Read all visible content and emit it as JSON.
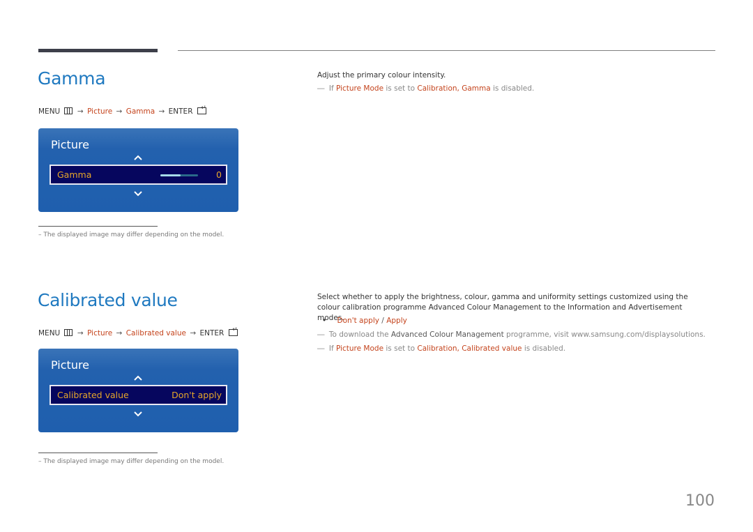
{
  "page_number": "100",
  "gamma": {
    "title": "Gamma",
    "menu_path": {
      "menu": "MENU",
      "arrow": "→",
      "items": [
        "Picture",
        "Gamma"
      ],
      "enter": "ENTER"
    },
    "osd": {
      "title": "Picture",
      "row_label": "Gamma",
      "row_value": "0",
      "slider_fraction": 0.53
    },
    "footnote": "–  The displayed image may differ depending on the model.",
    "description": "Adjust the primary colour intensity.",
    "note": {
      "dash": "―",
      "prefix": "If",
      "picture_mode": "Picture Mode",
      "mid": "is set to",
      "calibration": "Calibration,",
      "item": "Gamma",
      "suffix": "is disabled."
    }
  },
  "calibrated": {
    "title": "Calibrated value",
    "menu_path": {
      "menu": "MENU",
      "arrow": "→",
      "items": [
        "Picture",
        "Calibrated value"
      ],
      "enter": "ENTER"
    },
    "osd": {
      "title": "Picture",
      "row_label": "Calibrated value",
      "row_value": "Don't apply"
    },
    "footnote": "–  The displayed image may differ depending on the model.",
    "description_1": "Select whether to apply the brightness, colour, gamma and uniformity settings customized using the colour calibration programme",
    "description_bold": "Advanced Colour Management",
    "description_2": "to the Information and Advertisement modes.",
    "options": {
      "bullet": "•",
      "option_1": "Don't apply",
      "separator": "/",
      "option_2": "Apply"
    },
    "note_download": {
      "dash": "―",
      "prefix": "To download the",
      "program": "Advanced Colour Management",
      "suffix": "programme, visit www.samsung.com/displaysolutions."
    },
    "note_disabled": {
      "dash": "―",
      "prefix": "If",
      "picture_mode": "Picture Mode",
      "mid": "is set to",
      "calibration": "Calibration,",
      "item": "Calibrated value",
      "suffix": "is disabled."
    }
  },
  "colors": {
    "title_blue": "#1f79c0",
    "highlight_red": "#c4431c",
    "osd_blue": "#1f5fae",
    "osd_row_bg": "#06065e",
    "osd_text_gold": "#e6a62a"
  }
}
